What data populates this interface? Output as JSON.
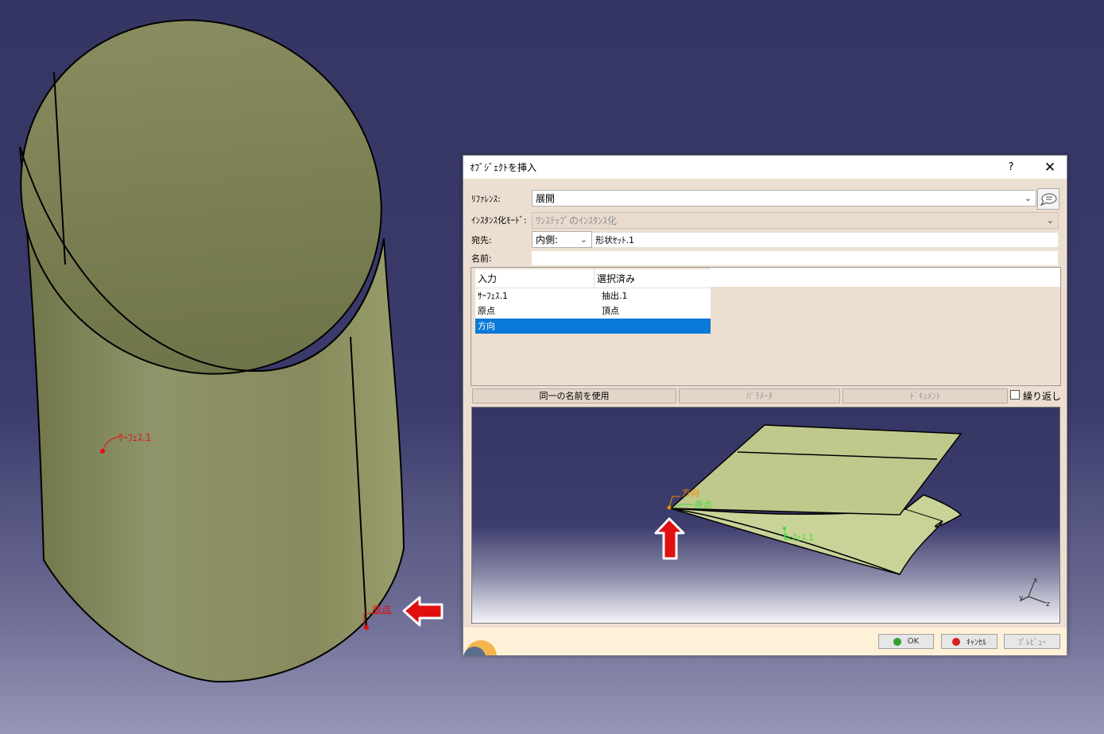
{
  "viewport": {
    "surface_label": "ｻｰﾌｪｽ.1",
    "origin_label": "原点"
  },
  "dialog": {
    "title": "ｵﾌﾞｼﾞｪｸﾄを挿入",
    "help": "?",
    "close": "✕",
    "reference_label": "ﾘﾌｧﾚﾝｽ:",
    "reference_value": "展開",
    "instantiation_mode_label": "ｲﾝｽﾀﾝｽ化ﾓｰﾄﾞ:",
    "instantiation_mode_value": "ﾜﾝｽﾃｯﾌﾟのｲﾝｽﾀﾝｽ化",
    "destination_label": "宛先:",
    "destination_combo": "内側:",
    "destination_value": "形状ｾｯﾄ.1",
    "name_label": "名前:",
    "name_value": "",
    "table": {
      "headers": [
        "入力",
        "選択済み"
      ],
      "rows": [
        {
          "input": "ｻｰﾌｪｽ.1",
          "selected": "抽出.1"
        },
        {
          "input": "原点",
          "selected": "頂点"
        },
        {
          "input": "方向",
          "selected": ""
        }
      ],
      "selected_row": 2
    },
    "buttons": {
      "use_same_name": "同一の名前を使用",
      "parameters": "ﾊﾟﾗﾒｰﾀ",
      "documents": "ﾄﾞｷｭﾒﾝﾄ",
      "repeat": "繰り返し",
      "ok": "OK",
      "cancel": "ｷｬﾝｾﾙ",
      "preview": "ﾌﾟﾚﾋﾞｭｰ"
    },
    "preview": {
      "direction_label": "方向",
      "origin_label": "原点",
      "surface_label": "ｻｰﾌｪｽ.1",
      "axis_x": "x",
      "axis_y": "y",
      "axis_z": "z"
    }
  },
  "colors": {
    "background": "#3b3b6c",
    "surface": "#8b8f5f",
    "selection": "#0a78d7",
    "dialog_bg": "#ecdfd1"
  }
}
